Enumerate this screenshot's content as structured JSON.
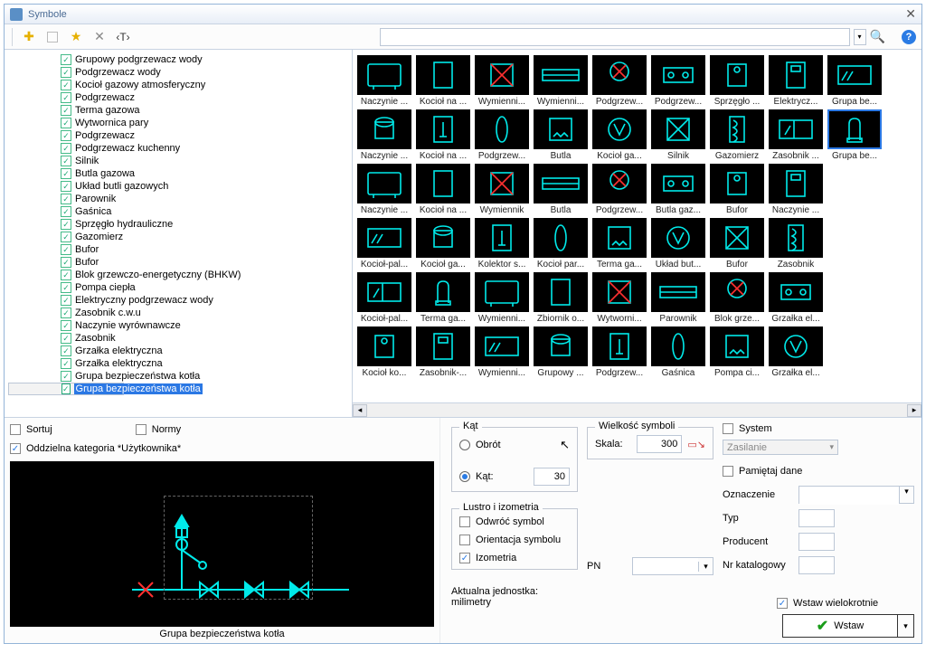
{
  "window": {
    "title": "Symbole"
  },
  "toolbar": {
    "search_placeholder": ""
  },
  "tree": {
    "items": [
      "Grupowy podgrzewacz wody",
      "Podgrzewacz wody",
      "Kocioł gazowy atmosferyczny",
      "Podgrzewacz",
      "Terma gazowa",
      "Wytwornica pary",
      "Podgrzewacz",
      "Podgrzewacz kuchenny",
      "Silnik",
      "Butla gazowa",
      "Układ butli gazowych",
      "Parownik",
      "Gaśnica",
      "Sprzęgło hydrauliczne",
      "Gazomierz",
      "Bufor",
      "Bufor",
      "Blok grzewczo-energetyczny (BHKW)",
      "Pompa ciepła",
      "Elektryczny podgrzewacz wody",
      "Zasobnik c.w.u",
      "Naczynie wyrównawcze",
      "Zasobnik",
      "Grzałka elektryczna",
      "Grzałka elektryczna",
      "Grupa bezpieczeństwa kotła",
      "Grupa bezpieczeństwa kotła"
    ],
    "selected_index": 26
  },
  "grid": {
    "rows": [
      [
        "Naczynie ...",
        "Kocioł na ...",
        "Wymienni...",
        "Wymienni...",
        "Podgrzew...",
        "Podgrzew...",
        "Sprzęgło ...",
        "Elektrycz...",
        "Grupa be..."
      ],
      [
        "Naczynie ...",
        "Kocioł na ...",
        "Podgrzew...",
        "Butla",
        "Kocioł ga...",
        "Silnik",
        "Gazomierz",
        "Zasobnik ...",
        "Grupa be..."
      ],
      [
        "Naczynie ...",
        "Kocioł na ...",
        "Wymiennik",
        "Butla",
        "Podgrzew...",
        "Butla gaz...",
        "Bufor",
        "Naczynie ...",
        null
      ],
      [
        "Kocioł-pal...",
        "Kocioł ga...",
        "Kolektor s...",
        "Kocioł par...",
        "Terma ga...",
        "Układ but...",
        "Bufor",
        "Zasobnik",
        null
      ],
      [
        "Kocioł-pal...",
        "Terma ga...",
        "Wymienni...",
        "Zbiornik o...",
        "Wytworni...",
        "Parownik",
        "Blok grze...",
        "Grzałka el...",
        null
      ],
      [
        "Kocioł ko...",
        "Zasobnik-...",
        "Wymienni...",
        "Grupowy ...",
        "Podgrzew...",
        "Gaśnica",
        "Pompa ci...",
        "Grzałka el...",
        null
      ]
    ],
    "selected": [
      1,
      8
    ]
  },
  "options": {
    "sort": "Sortuj",
    "norms": "Normy",
    "user_cat": "Oddzielna kategoria *Użytkownika*",
    "user_cat_checked": true
  },
  "preview": {
    "caption": "Grupa bezpieczeństwa kotła"
  },
  "angle": {
    "group": "Kąt",
    "rotation": "Obrót",
    "angle": "Kąt:",
    "angle_value": "30"
  },
  "mirror": {
    "group": "Lustro i izometria",
    "flip": "Odwróć symbol",
    "orient": "Orientacja symbolu",
    "iso": "Izometria",
    "iso_checked": true
  },
  "size": {
    "group": "Wielkość symboli",
    "scale": "Skala:",
    "scale_value": "300"
  },
  "pn": {
    "label": "PN"
  },
  "right": {
    "system": "System",
    "system_placeholder": "Zasilanie",
    "remember": "Pamiętaj dane",
    "mark": "Oznaczenie",
    "type": "Typ",
    "manuf": "Producent",
    "catalog": "Nr katalogowy",
    "multi": "Wstaw wielokrotnie",
    "multi_checked": true,
    "insert": "Wstaw"
  },
  "unit": {
    "label": "Aktualna jednostka: milimetry"
  }
}
